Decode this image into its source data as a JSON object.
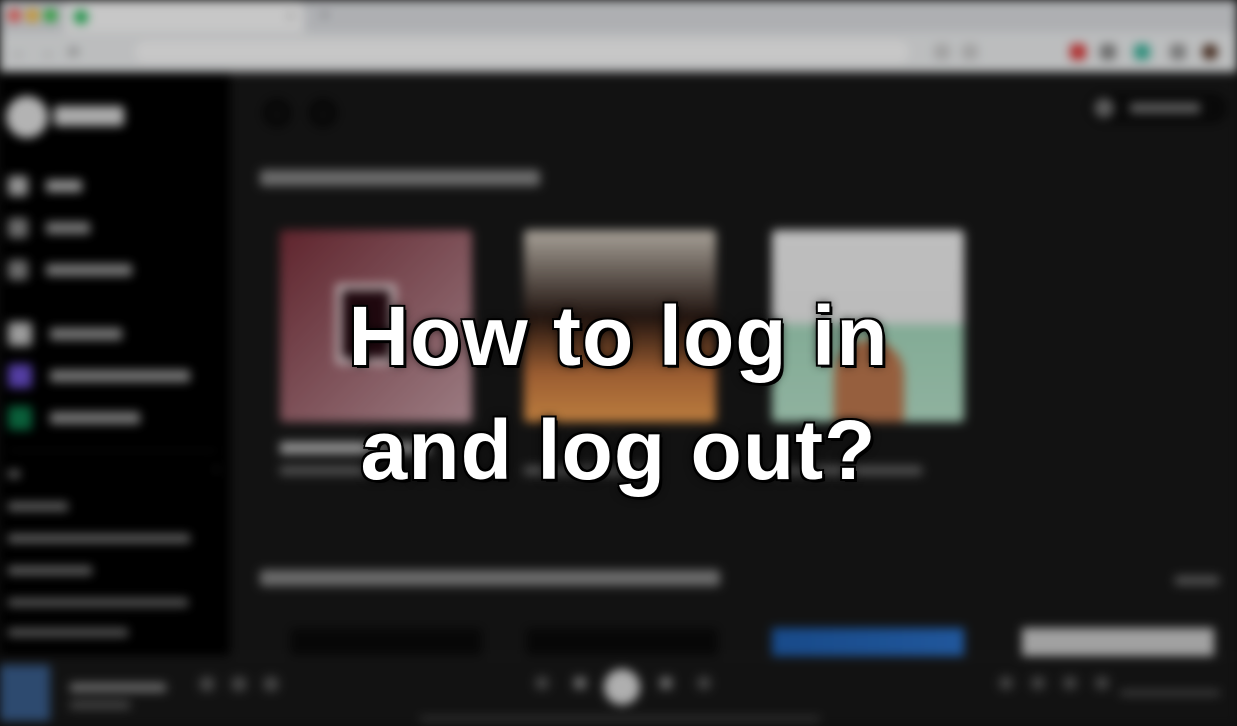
{
  "headline": {
    "line1": "How to log in",
    "line2": "and log out?"
  },
  "background_app": {
    "blurred": true,
    "colors": {
      "sidebar": "#000000",
      "main": "#181818",
      "player": "#181818",
      "accent": "#1db954"
    },
    "browser": {
      "new_tab_glyph": "+",
      "tab_close_glyph": "×",
      "nav_back_glyph": "←",
      "nav_forward_glyph": "→",
      "reload_glyph": "⟳"
    },
    "main": {
      "nav_back_glyph": "‹",
      "nav_forward_glyph": "›"
    },
    "player": {
      "play_glyph": "▶"
    }
  },
  "icons": [
    "tab-favicon-icon",
    "spotify-logo-icon",
    "home-icon",
    "search-icon",
    "library-icon",
    "create-playlist-icon",
    "liked-songs-icon",
    "episodes-icon",
    "user-icon",
    "play-icon",
    "volume-icon"
  ]
}
